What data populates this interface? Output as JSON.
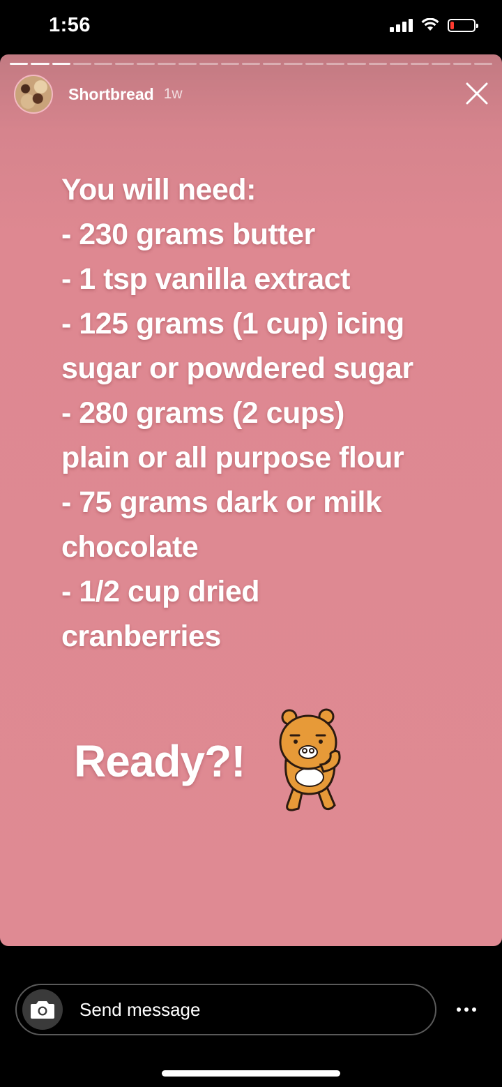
{
  "status_bar": {
    "time": "1:56",
    "icons": [
      "signal-icon",
      "wifi-icon",
      "battery-low-icon"
    ],
    "battery_color": "#ff3b30"
  },
  "story": {
    "progress_segments_total": 23,
    "progress_segments_viewed": 3,
    "username": "Shortbread",
    "timestamp": "1w",
    "background_color": "#df8a93",
    "lines": [
      "You will need:",
      "- 230 grams butter",
      "- 1 tsp vanilla extract",
      "- 125 grams (1 cup) icing",
      "sugar or powdered sugar",
      "- 280 grams (2 cups)",
      "plain or all purpose flour",
      "- 75 grams dark or milk",
      "chocolate",
      "- 1/2 cup dried",
      "cranberries"
    ],
    "ready_text": "Ready?!",
    "sticker": "bear-sticker"
  },
  "message_bar": {
    "placeholder": "Send message",
    "camera_icon": "camera-icon",
    "more_icon": "more-options-icon"
  }
}
